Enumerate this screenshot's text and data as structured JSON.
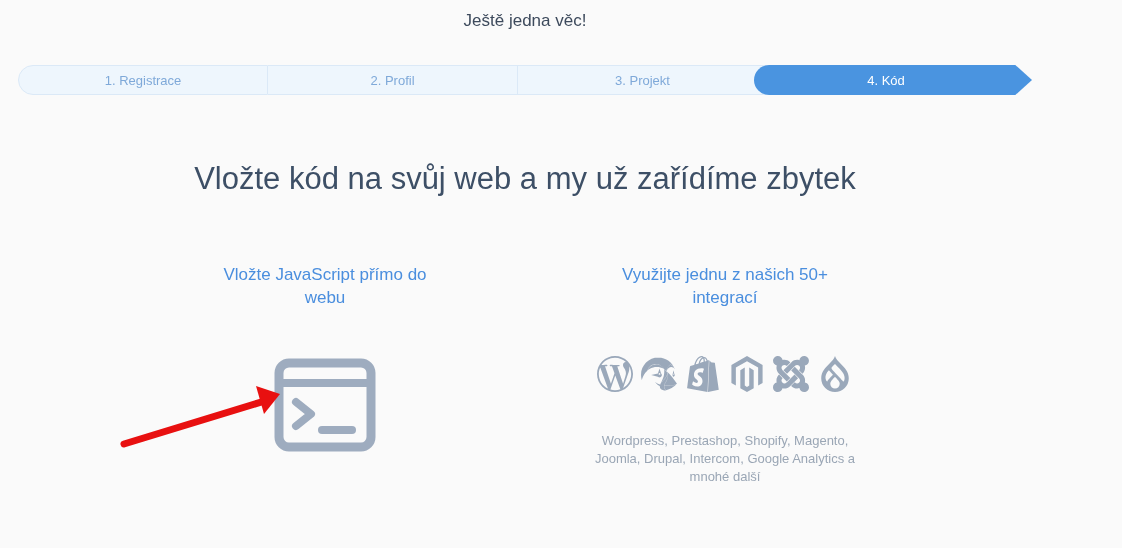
{
  "title": "Ještě jedna věc!",
  "steps": [
    {
      "label": "1. Registrace",
      "selected": false
    },
    {
      "label": "2. Profil",
      "selected": false
    },
    {
      "label": "3. Projekt",
      "selected": false
    },
    {
      "label": "4. Kód",
      "selected": true
    }
  ],
  "heading": "Vložte kód na svůj web a my už zařídíme zbytek",
  "options": [
    {
      "kind": "script",
      "title": "Vložte JavaScript přímo do webu"
    },
    {
      "kind": "integrations",
      "title": "Využijte jednu z našich 50+ integrací",
      "caption": "Wordpress, Prestashop, Shopify, Magento, Joomla, Drupal, Intercom, Google Analytics a mnohé další"
    }
  ]
}
